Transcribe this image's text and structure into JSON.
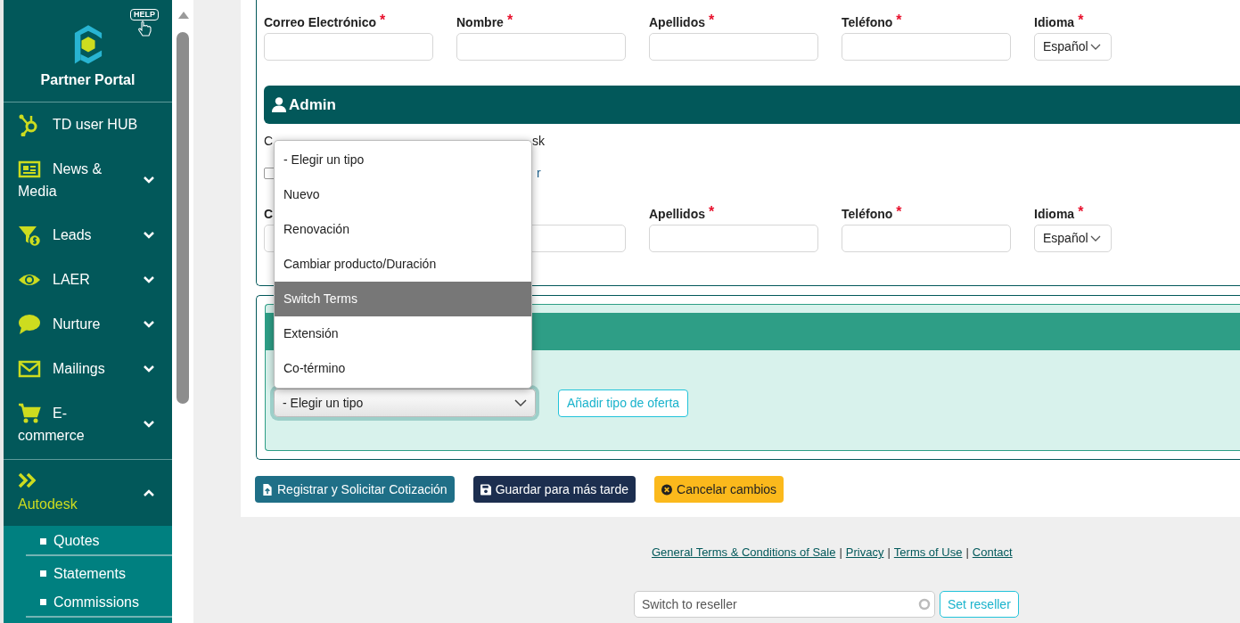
{
  "sidebar": {
    "help": "HELP",
    "brand": "Partner Portal",
    "items": [
      {
        "kind": "link",
        "label_lines": [
          "TD user HUB"
        ],
        "selected": false
      },
      {
        "kind": "menu",
        "label_lines": [
          "News &",
          "Media"
        ],
        "expanded": false,
        "selected": false
      },
      {
        "kind": "menu",
        "label_lines": [
          "Leads"
        ],
        "expanded": false,
        "selected": false
      },
      {
        "kind": "menu",
        "label_lines": [
          "LAER"
        ],
        "expanded": false,
        "selected": false
      },
      {
        "kind": "menu",
        "label_lines": [
          "Nurture"
        ],
        "expanded": false,
        "selected": false
      },
      {
        "kind": "menu",
        "label_lines": [
          "Mailings"
        ],
        "expanded": false,
        "selected": false
      },
      {
        "kind": "menu",
        "label_lines": [
          "E-",
          "commerce"
        ],
        "expanded": false,
        "selected": false
      },
      {
        "kind": "menu",
        "label_lines": [
          "Autodesk"
        ],
        "expanded": true,
        "selected": true,
        "children": [
          {
            "label": "Quotes"
          },
          {
            "label": "Statements"
          },
          {
            "label": "Commissions"
          }
        ]
      }
    ]
  },
  "contact_fields": [
    {
      "kind": "input",
      "label": "Correo Electrónico",
      "required_mark": "*"
    },
    {
      "kind": "input",
      "label": "Nombre",
      "required_mark": "*"
    },
    {
      "kind": "input",
      "label": "Apellidos",
      "required_mark": "*"
    },
    {
      "kind": "input",
      "label": "Teléfono",
      "required_mark": "*"
    },
    {
      "kind": "select",
      "label": "Idioma",
      "required_mark": "*",
      "value": "Español"
    }
  ],
  "admin": {
    "title": "Admin",
    "description_start": "C",
    "description_end": "sk",
    "checkbox": {
      "checked": false,
      "label_end": "r"
    },
    "fields": [
      {
        "kind": "input",
        "label": "C"
      },
      {
        "kind": "input"
      },
      {
        "kind": "input",
        "label": "Apellidos",
        "required_mark": "*"
      },
      {
        "kind": "input",
        "label": "Teléfono",
        "required_mark": "*"
      },
      {
        "kind": "select",
        "label": "Idioma",
        "required_mark": "*",
        "value": "Español"
      }
    ]
  },
  "offer": {
    "select_value": "- Elegir un tipo",
    "add_button": "Añadir tipo de oferta",
    "options": [
      {
        "label": "- Elegir un tipo",
        "selected": false
      },
      {
        "label": "Nuevo",
        "selected": false
      },
      {
        "label": "Renovación",
        "selected": false
      },
      {
        "label": "Cambiar producto/Duración",
        "selected": false
      },
      {
        "label": "Switch Terms",
        "selected": true
      },
      {
        "label": "Extensión",
        "selected": false
      },
      {
        "label": "Co-término",
        "selected": false
      }
    ]
  },
  "actions": [
    {
      "kind": "register",
      "label": "Registrar y Solicitar Cotización"
    },
    {
      "kind": "save",
      "label": "Guardar para más tarde"
    },
    {
      "kind": "cancel",
      "label": "Cancelar cambios"
    }
  ],
  "footer": {
    "items": [
      {
        "kind": "link",
        "text": "General Terms & Conditions of Sale"
      },
      {
        "kind": "separator",
        "text": "|"
      },
      {
        "kind": "link",
        "text": "Privacy"
      },
      {
        "kind": "separator",
        "text": "|"
      },
      {
        "kind": "link",
        "text": "Terms of Use"
      },
      {
        "kind": "separator",
        "text": "|"
      },
      {
        "kind": "link",
        "text": "Contact"
      }
    ],
    "reseller_placeholder": "Switch to reseller",
    "reseller_button": "Set reseller"
  }
}
